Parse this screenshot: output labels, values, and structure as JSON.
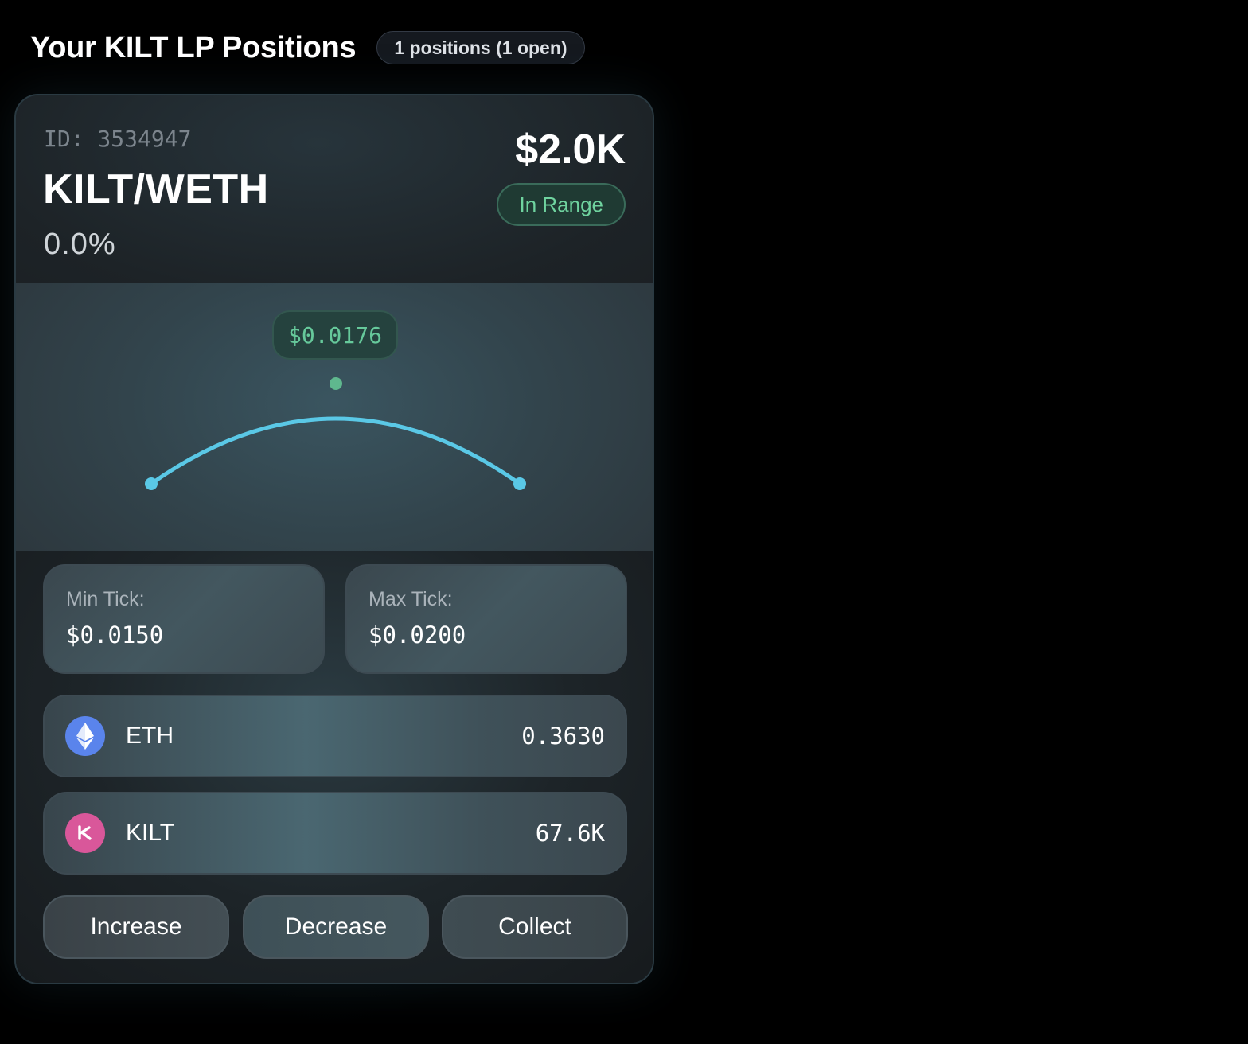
{
  "header": {
    "title": "Your KILT LP Positions",
    "badge": "1 positions (1 open)"
  },
  "position": {
    "id_label": "ID: 3534947",
    "pair": "KILT/WETH",
    "percent": "0.0%",
    "value": "$2.0K",
    "status": "In Range",
    "current_price": "$0.0176",
    "min_tick_label": "Min Tick:",
    "min_tick_value": "$0.0150",
    "max_tick_label": "Max Tick:",
    "max_tick_value": "$0.0200",
    "tokens": [
      {
        "symbol": "ETH",
        "amount": "0.3630",
        "icon": "ethereum-icon",
        "color": "#5a84ec"
      },
      {
        "symbol": "KILT",
        "amount": "67.6K",
        "icon": "kilt-icon",
        "color": "#d9579a"
      }
    ],
    "actions": {
      "increase": "Increase",
      "decrease": "Decrease",
      "collect": "Collect"
    }
  },
  "colors": {
    "in_range_green": "#6fd39f",
    "range_curve": "#5ac8e6",
    "price_dot": "#5fb88e"
  }
}
